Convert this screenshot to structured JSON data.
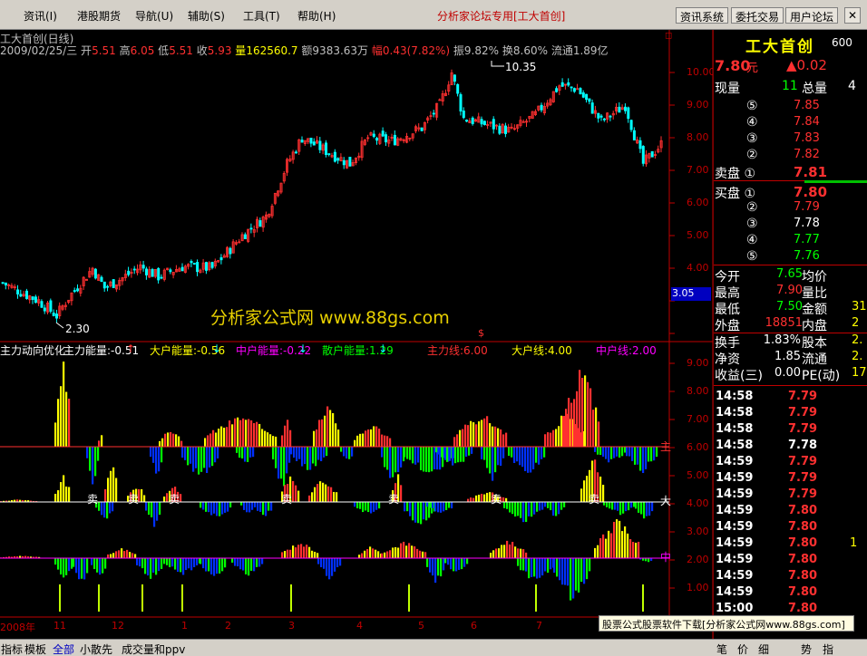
{
  "menu": {
    "items": [
      "资讯(I)",
      "港股期货",
      "导航(U)",
      "辅助(S)",
      "工具(T)",
      "帮助(H)"
    ],
    "brand": "分析家论坛专用[工大首创]",
    "buttons": [
      "资讯系统",
      "委托交易",
      "用户论坛"
    ]
  },
  "chart": {
    "title": "工大首创(日线)",
    "info": {
      "date": "2009/02/25/三",
      "open_label": "开",
      "open": "5.51",
      "high_label": "高",
      "high": "6.05",
      "low_label": "低",
      "low": "5.51",
      "close_label": "收",
      "close": "5.93",
      "vol_label": "量",
      "vol": "162560.7",
      "amt_label": "额",
      "amt": "9383.63万",
      "chg_label": "幅",
      "chg": "0.43(7.82%)",
      "amp": "振9.82%",
      "turnover": "换8.60%",
      "float": "流通1.89亿"
    },
    "marker_high": "10.35",
    "marker_low": "2.30",
    "price_tag": "3.05",
    "watermark": "分析家公式网 www.88gs.com",
    "dollar_mark": "$",
    "indicator": {
      "name": "主力动向优化",
      "items": [
        {
          "text": "主力能量:-0.51",
          "color": "#ffffff",
          "arrow": "↑",
          "arrow_color": "#ff3030"
        },
        {
          "text": "大户能量:-0.56",
          "color": "#ffff00",
          "arrow": "↓",
          "arrow_color": "#00ffff"
        },
        {
          "text": "中户能量:-0.22",
          "color": "#ff00ff",
          "arrow": "↓",
          "arrow_color": "#00ffff"
        },
        {
          "text": "散户能量:1.29",
          "color": "#00ff00",
          "arrow": "↓",
          "arrow_color": "#00ffff"
        },
        {
          "text": "主力线:6.00",
          "color": "#ff3030",
          "arrow": "",
          "arrow_color": ""
        },
        {
          "text": "大户线:4.00",
          "color": "#ffff00",
          "arrow": "",
          "arrow_color": ""
        },
        {
          "text": "中户线:2.00",
          "color": "#ff00ff",
          "arrow": "",
          "arrow_color": ""
        }
      ],
      "line_labels": [
        "主",
        "大",
        "中"
      ],
      "sell_label": "卖"
    },
    "price_axis": [
      "10.00",
      "9.00",
      "8.00",
      "7.00",
      "6.00",
      "5.00",
      "4.00"
    ],
    "ind_axis": [
      "9.00",
      "8.00",
      "7.00",
      "6.00",
      "5.00",
      "4.00",
      "3.00",
      "2.00",
      "1.00"
    ],
    "date_labels": [
      "2008年",
      "11",
      "12",
      "1",
      "2",
      "3",
      "4",
      "5",
      "6",
      "7"
    ],
    "colors": {
      "up": "#ff3030",
      "down": "#00ffff",
      "axis": "#c00000"
    }
  },
  "quote": {
    "name": "工大首创",
    "code": "600",
    "price": "7.80",
    "price_unit": "元",
    "change": "▲0.02",
    "volume_label": "现量",
    "volume": "11",
    "total_label": "总量",
    "total": "4",
    "sells": [
      {
        "label": "⑤",
        "price": "7.85"
      },
      {
        "label": "④",
        "price": "7.84"
      },
      {
        "label": "③",
        "price": "7.83"
      },
      {
        "label": "②",
        "price": "7.82"
      },
      {
        "label": "卖盘 ①",
        "price": "7.81"
      }
    ],
    "buys": [
      {
        "label": "买盘 ①",
        "price": "7.80",
        "color": "#ff3030"
      },
      {
        "label": "②",
        "price": "7.79",
        "color": "#ff3030"
      },
      {
        "label": "③",
        "price": "7.78",
        "color": "#ffffff"
      },
      {
        "label": "④",
        "price": "7.77",
        "color": "#00ff00"
      },
      {
        "label": "⑤",
        "price": "7.76",
        "color": "#00ff00"
      }
    ],
    "stats": [
      {
        "l": "今开",
        "v": "7.65",
        "vc": "#00ff00",
        "l2": "均价",
        "v2": ""
      },
      {
        "l": "最高",
        "v": "7.90",
        "vc": "#ff3030",
        "l2": "量比",
        "v2": ""
      },
      {
        "l": "最低",
        "v": "7.50",
        "vc": "#00ff00",
        "l2": "金额",
        "v2": "31"
      },
      {
        "l": "外盘",
        "v": "18851",
        "vc": "#ff3030",
        "l2": "内盘",
        "v2": "2"
      },
      {
        "l": "换手",
        "v": "1.83%",
        "vc": "#ffffff",
        "l2": "股本",
        "v2": "2."
      },
      {
        "l": "净资",
        "v": "1.85",
        "vc": "#ffffff",
        "l2": "流通",
        "v2": "2."
      },
      {
        "l": "收益(三)",
        "v": "0.00",
        "vc": "#ffffff",
        "l2": "PE(动)",
        "v2": "17"
      }
    ],
    "ticks": [
      {
        "t": "14:58",
        "p": "7.79",
        "c": "#ff3030",
        "v": ""
      },
      {
        "t": "14:58",
        "p": "7.79",
        "c": "#ff3030",
        "v": ""
      },
      {
        "t": "14:58",
        "p": "7.79",
        "c": "#ff3030",
        "v": ""
      },
      {
        "t": "14:58",
        "p": "7.78",
        "c": "#ffffff",
        "v": ""
      },
      {
        "t": "14:59",
        "p": "7.79",
        "c": "#ff3030",
        "v": ""
      },
      {
        "t": "14:59",
        "p": "7.79",
        "c": "#ff3030",
        "v": ""
      },
      {
        "t": "14:59",
        "p": "7.79",
        "c": "#ff3030",
        "v": ""
      },
      {
        "t": "14:59",
        "p": "7.80",
        "c": "#ff3030",
        "v": ""
      },
      {
        "t": "14:59",
        "p": "7.80",
        "c": "#ff3030",
        "v": ""
      },
      {
        "t": "14:59",
        "p": "7.80",
        "c": "#ff3030",
        "v": "1"
      },
      {
        "t": "14:59",
        "p": "7.80",
        "c": "#ff3030",
        "v": ""
      },
      {
        "t": "14:59",
        "p": "7.80",
        "c": "#ff3030",
        "v": ""
      },
      {
        "t": "14:59",
        "p": "7.80",
        "c": "#ff3030",
        "v": ""
      },
      {
        "t": "15:00",
        "p": "7.80",
        "c": "#ff3030",
        "v": ""
      }
    ]
  },
  "status": {
    "tabs": [
      "指标",
      "模板",
      "全部",
      "小散先",
      "成交量和ppv"
    ],
    "right_tabs": [
      "笔",
      "价",
      "细",
      "势",
      "指"
    ],
    "watermark": "股票公式股票软件下载[分析家公式网www.88gs.com]"
  }
}
